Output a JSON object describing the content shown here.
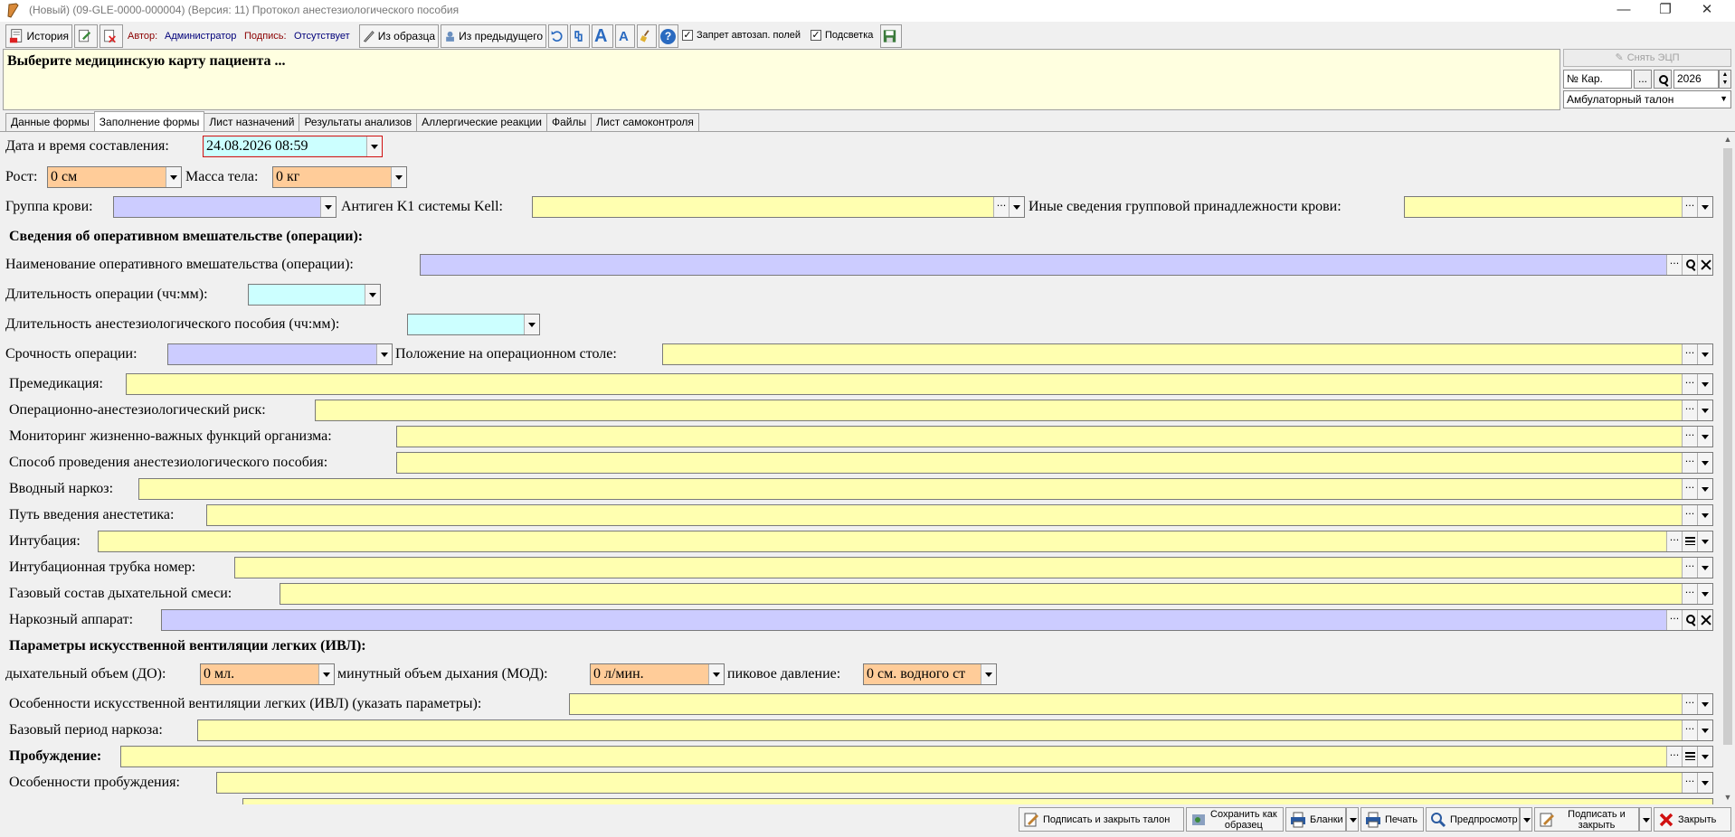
{
  "window": {
    "title": "(Новый) (09-GLE-0000-000004) (Версия: 11) Протокол анестезиологического пособия",
    "minimize": "—",
    "restore": "❐",
    "close": "✕"
  },
  "toolbar": {
    "history": "История",
    "author_label": "Автор:",
    "author": "Администратор",
    "signature_label": "Подпись:",
    "signature": "Отсутствует",
    "from_template": "Из образца",
    "from_previous": "Из предыдущего",
    "font_up": "A",
    "font_down": "A",
    "help": "?",
    "autofill_ban": "Запрет автозап. полей",
    "highlight": "Подсветка"
  },
  "patient": {
    "message": "Выберите медицинскую карту пациента ..."
  },
  "right_panel": {
    "remove_signature": "Снять ЭЦП",
    "card_number_placeholder": "№ Кар.",
    "ellipsis": "...",
    "year": "2026",
    "document_type": "Амбулаторный талон"
  },
  "tabs": [
    {
      "label": "Данные формы"
    },
    {
      "label": "Заполнение формы"
    },
    {
      "label": "Лист назначений"
    },
    {
      "label": "Результаты анализов"
    },
    {
      "label": "Аллергические реакции"
    },
    {
      "label": "Файлы"
    },
    {
      "label": "Лист самоконтроля"
    }
  ],
  "form": {
    "datetime": {
      "label": "Дата и время составления:",
      "value": "24.08.2026 08:59"
    },
    "height": {
      "label": "Рост:",
      "value": "0 см"
    },
    "weight": {
      "label": "Масса тела:",
      "value": "0 кг"
    },
    "blood_group": {
      "label": "Группа крови:",
      "value": ""
    },
    "kell": {
      "label": "Антиген K1 системы Kell:",
      "value": ""
    },
    "other_blood": {
      "label": "Иные сведения групповой принадлежности крови:",
      "value": ""
    },
    "section_operation": "Сведения об оперативном вмешательстве (операции):",
    "operation_name": {
      "label": "Наименование оперативного вмешательства (операции):",
      "value": ""
    },
    "operation_duration": {
      "label": "Длительность операции (чч:мм):",
      "value": ""
    },
    "anesthesia_duration": {
      "label": "Длительность анестезиологического пособия (чч:мм):",
      "value": ""
    },
    "urgency": {
      "label": "Срочность операции:",
      "value": ""
    },
    "position": {
      "label": "Положение на операционном столе:",
      "value": ""
    },
    "premedication": {
      "label": "Премедикация:",
      "value": ""
    },
    "risk": {
      "label": "Операционно-анестезиологический риск:",
      "value": ""
    },
    "monitoring": {
      "label": "Мониторинг жизненно-важных функций организма:",
      "value": ""
    },
    "anesthesia_method": {
      "label": "Способ проведения анестезиологического пособия:",
      "value": ""
    },
    "induction": {
      "label": "Вводный наркоз:",
      "value": ""
    },
    "route": {
      "label": "Путь введения анестетика:",
      "value": ""
    },
    "intubation": {
      "label": "Интубация:",
      "value": ""
    },
    "tube_number": {
      "label": "Интубационная трубка номер:",
      "value": ""
    },
    "gas_mix": {
      "label": "Газовый состав дыхательной смеси:",
      "value": ""
    },
    "machine": {
      "label": "Наркозный аппарат:",
      "value": ""
    },
    "section_ivl": "Параметры искусственной вентиляции легких (ИВЛ):",
    "tidal_volume": {
      "label": "дыхательный объем (ДО):",
      "value": "0 мл."
    },
    "minute_volume": {
      "label": "минутный объем дыхания (МОД):",
      "value": "0 л/мин."
    },
    "peak_pressure": {
      "label": "пиковое давление:",
      "value": "0 см. водного ст"
    },
    "ivl_features": {
      "label": "Особенности искусственной вентиляции легких (ИВЛ) (указать параметры):",
      "value": ""
    },
    "base_period": {
      "label": "Базовый период наркоза:",
      "value": ""
    },
    "awakening": {
      "label": "Пробуждение:",
      "value": ""
    },
    "awakening_features": {
      "label": "Особенности пробуждения:",
      "value": ""
    }
  },
  "bottom": {
    "sign_close_ticket": "Подписать и закрыть талон",
    "save_template_1": "Сохранить как",
    "save_template_2": "образец",
    "blanks": "Бланки",
    "print": "Печать",
    "preview": "Предпросмотр",
    "sign_close_1": "Подписать и",
    "sign_close_2": "закрыть",
    "close": "Закрыть"
  }
}
